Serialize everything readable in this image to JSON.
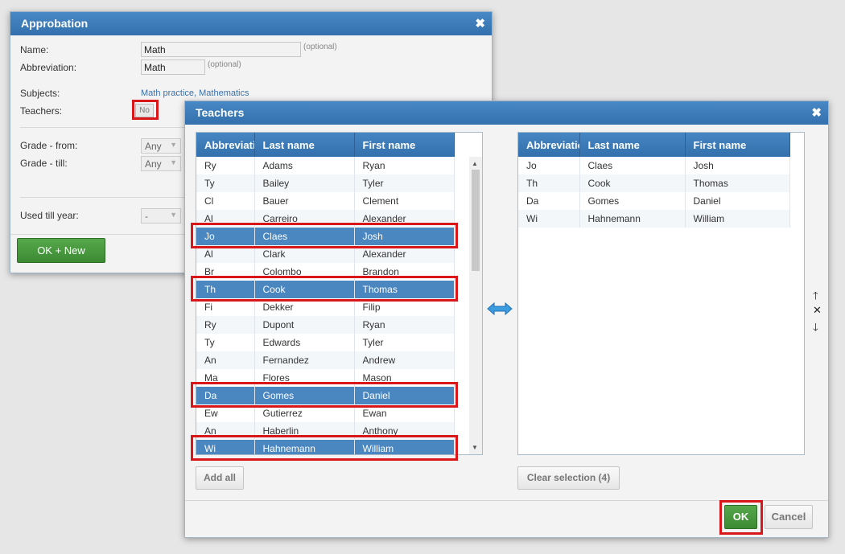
{
  "approbation": {
    "title": "Approbation",
    "name_label": "Name:",
    "name_value": "Math",
    "name_hint": "(optional)",
    "abbr_label": "Abbreviation:",
    "abbr_value": "Math",
    "abbr_hint": "(optional)",
    "subjects_label": "Subjects:",
    "subjects_value": "Math practice, Mathematics",
    "teachers_label": "Teachers:",
    "teachers_value": "No",
    "grade_from_label": "Grade - from:",
    "grade_from_value": "Any",
    "grade_till_label": "Grade - till:",
    "grade_till_value": "Any",
    "used_till_label": "Used till year:",
    "used_till_value": "-",
    "ok_new_label": "OK + New"
  },
  "teachers": {
    "title": "Teachers",
    "columns": [
      "Abbreviation",
      "Last name",
      "First name"
    ],
    "left_rows": [
      {
        "abbr": "Ry",
        "last": "Adams",
        "first": "Ryan",
        "selected": false
      },
      {
        "abbr": "Ty",
        "last": "Bailey",
        "first": "Tyler",
        "selected": false
      },
      {
        "abbr": "Cl",
        "last": "Bauer",
        "first": "Clement",
        "selected": false
      },
      {
        "abbr": "Al",
        "last": "Carreiro",
        "first": "Alexander",
        "selected": false
      },
      {
        "abbr": "Jo",
        "last": "Claes",
        "first": "Josh",
        "selected": true
      },
      {
        "abbr": "Al",
        "last": "Clark",
        "first": "Alexander",
        "selected": false
      },
      {
        "abbr": "Br",
        "last": "Colombo",
        "first": "Brandon",
        "selected": false
      },
      {
        "abbr": "Th",
        "last": "Cook",
        "first": "Thomas",
        "selected": true
      },
      {
        "abbr": "Fi",
        "last": "Dekker",
        "first": "Filip",
        "selected": false
      },
      {
        "abbr": "Ry",
        "last": "Dupont",
        "first": "Ryan",
        "selected": false
      },
      {
        "abbr": "Ty",
        "last": "Edwards",
        "first": "Tyler",
        "selected": false
      },
      {
        "abbr": "An",
        "last": "Fernandez",
        "first": "Andrew",
        "selected": false
      },
      {
        "abbr": "Ma",
        "last": "Flores",
        "first": "Mason",
        "selected": false
      },
      {
        "abbr": "Da",
        "last": "Gomes",
        "first": "Daniel",
        "selected": true
      },
      {
        "abbr": "Ew",
        "last": "Gutierrez",
        "first": "Ewan",
        "selected": false
      },
      {
        "abbr": "An",
        "last": "Haberlin",
        "first": "Anthony",
        "selected": false
      },
      {
        "abbr": "Wi",
        "last": "Hahnemann",
        "first": "William",
        "selected": true
      }
    ],
    "right_rows": [
      {
        "abbr": "Jo",
        "last": "Claes",
        "first": "Josh"
      },
      {
        "abbr": "Th",
        "last": "Cook",
        "first": "Thomas"
      },
      {
        "abbr": "Da",
        "last": "Gomes",
        "first": "Daniel"
      },
      {
        "abbr": "Wi",
        "last": "Hahnemann",
        "first": "William"
      }
    ],
    "add_all_label": "Add all",
    "clear_selection_label": "Clear selection (4)",
    "ok_label": "OK",
    "cancel_label": "Cancel"
  },
  "icons": {
    "close": "close-icon",
    "transfer": "swap-arrows-icon",
    "move_up": "arrow-up-icon",
    "remove": "remove-x-icon",
    "move_down": "arrow-down-icon"
  },
  "colors": {
    "header_blue": "#3a7ab8",
    "selected_row": "#4a86c0",
    "highlight_red": "#d9171b",
    "ok_green": "#3c8a33"
  }
}
